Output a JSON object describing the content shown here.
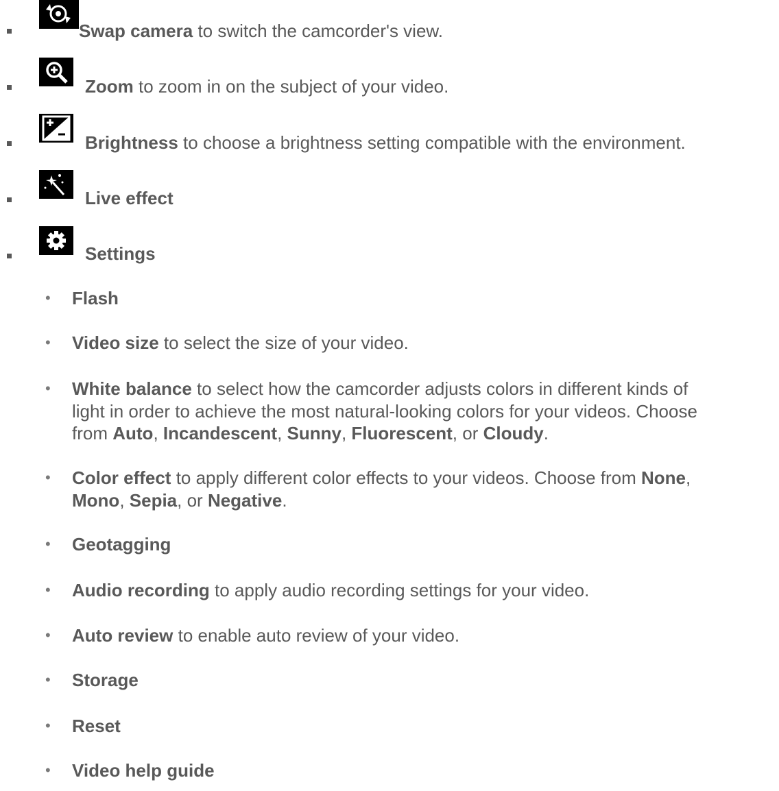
{
  "top_items": {
    "swap": {
      "label": "Swap camera",
      "desc": " to switch the camcorder's view.",
      "icon": "swap-camera-icon"
    },
    "zoom": {
      "label": "Zoom",
      "desc": " to zoom in on the subject of your video.",
      "icon": "zoom-in-icon"
    },
    "brightness": {
      "label": "Brightness",
      "desc": " to choose a brightness setting compatible with the environment.",
      "icon": "brightness-icon"
    },
    "live": {
      "label": "Live effect",
      "icon": "magic-wand-icon"
    },
    "settings": {
      "label": "Settings",
      "icon": "gear-icon"
    }
  },
  "settings": {
    "flash": {
      "label": "Flash"
    },
    "video_size": {
      "label": "Video size",
      "desc": " to select the size of your video."
    },
    "white_balance": {
      "label": "White balance",
      "desc_line1": " to select how the camcorder adjusts colors in different kinds of",
      "desc_line2": "light in order to achieve the most natural-looking colors for your videos. Choose",
      "from": "from ",
      "opts": [
        "Auto",
        "Incandescent",
        "Sunny",
        "Fluorescent",
        "Cloudy"
      ],
      "sep": ", ",
      "sep_or": ", or ",
      "end": "."
    },
    "color_effect": {
      "label": "Color effect",
      "desc": " to apply different color effects to your videos. Choose from ",
      "opts": [
        "None",
        "Mono",
        "Sepia",
        "Negative"
      ],
      "sep": ", ",
      "sep_or": ", or ",
      "end": "."
    },
    "geotagging": {
      "label": "Geotagging"
    },
    "audio": {
      "label": "Audio recording",
      "desc": " to apply audio recording settings for your video."
    },
    "auto_review": {
      "label": "Auto review",
      "desc": " to enable auto review of your video."
    },
    "storage": {
      "label": "Storage"
    },
    "reset": {
      "label": "Reset"
    },
    "help": {
      "label": "Video help guide"
    }
  },
  "bullet_dot": "•"
}
